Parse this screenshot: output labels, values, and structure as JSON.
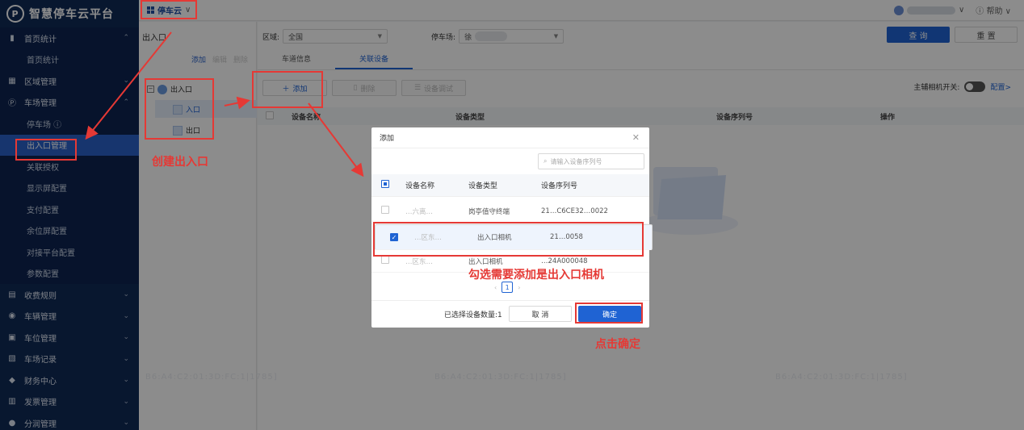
{
  "sidebar": {
    "app_title": "智慧停车云平台",
    "groups": [
      {
        "icon": "bar-chart-icon",
        "label": "首页统计",
        "chev": "⌃"
      },
      {
        "sub": "首页统计"
      },
      {
        "icon": "map-icon",
        "label": "区域管理",
        "chev": "⌄"
      },
      {
        "icon": "parking-icon",
        "label": "车场管理",
        "chev": "⌃"
      },
      {
        "sub": "停车场 ⓘ"
      },
      {
        "sub": "出入口管理",
        "active": true
      },
      {
        "sub": "关联授权"
      },
      {
        "sub": "显示屏配置"
      },
      {
        "sub": "支付配置"
      },
      {
        "sub": "余位屏配置"
      },
      {
        "sub": "对接平台配置"
      },
      {
        "sub": "参数配置"
      },
      {
        "icon": "fee-icon",
        "label": "收费规则",
        "chev": "⌄"
      },
      {
        "icon": "car-icon",
        "label": "车辆管理",
        "chev": "⌄"
      },
      {
        "icon": "space-icon",
        "label": "车位管理",
        "chev": "⌄"
      },
      {
        "icon": "record-icon",
        "label": "车场记录",
        "chev": "⌄"
      },
      {
        "icon": "finance-icon",
        "label": "财务中心",
        "chev": "⌄"
      },
      {
        "icon": "invoice-icon",
        "label": "发票管理",
        "chev": "⌄"
      },
      {
        "icon": "share-icon",
        "label": "分润管理",
        "chev": "⌄"
      }
    ]
  },
  "topbar": {
    "brand": "停车云",
    "help": "帮助"
  },
  "tree": {
    "title": "出入口",
    "actions": {
      "add": "添加",
      "edit": "编辑",
      "del": "删除"
    },
    "root": "出入口",
    "entry": "入口",
    "exit": "出口"
  },
  "filters": {
    "area_label": "区域:",
    "area_value": "全国",
    "lot_label": "停车场:",
    "lot_value": "徐",
    "query": "查 询",
    "reset": "重 置"
  },
  "tabs": [
    "车道信息",
    "关联设备"
  ],
  "toolbar": {
    "add": "添加",
    "delete": "删除",
    "debug": "设备调试",
    "switch_label": "主辅相机开关:",
    "config": "配置>"
  },
  "table_head": [
    "设备名称",
    "设备类型",
    "设备序列号",
    "操作"
  ],
  "modal": {
    "title": "添加",
    "search_placeholder": "请输入设备序列号",
    "columns": [
      "设备名称",
      "设备类型",
      "设备序列号"
    ],
    "rows": [
      {
        "name": "…六离…",
        "type": "岗亭值守终端",
        "serial": "21…C6CE32…0022",
        "checked": false
      },
      {
        "name": "…区东…",
        "type": "出入口相机",
        "serial": "21…0058",
        "checked": true
      },
      {
        "name": "…区东…",
        "type": "出入口相机",
        "serial": "…24A000048",
        "checked": false
      }
    ],
    "page": "1",
    "selected_count": "已选择设备数量:1",
    "cancel": "取 消",
    "ok": "确定"
  },
  "annotations": {
    "create": "创建出入口",
    "check": "勾选需要添加是出入口相机",
    "click_ok": "点击确定"
  },
  "watermark": "B6:A4:C2:01:3D:FC:1|1785]"
}
